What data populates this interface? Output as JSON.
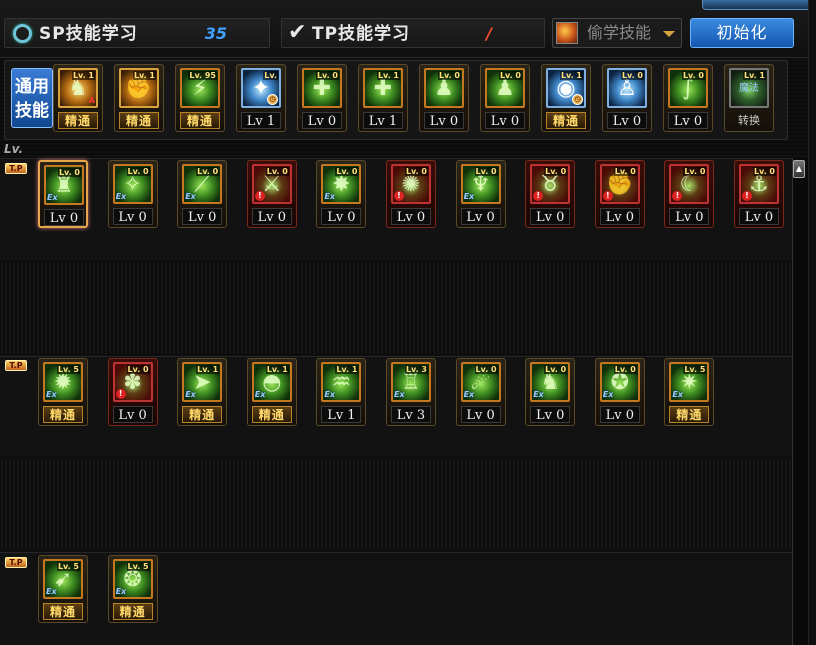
{
  "header": {
    "sp_label": "SP技能学习",
    "sp_value": "35",
    "tp_label": "TP技能学习",
    "tp_value": "/",
    "steal_label": "偷学技能",
    "reset_label": "初始化"
  },
  "common": {
    "label_line1": "通用",
    "label_line2": "技能",
    "items": [
      {
        "badge": "Lv. 1",
        "caption": "精通",
        "kind": "master",
        "style": "gold",
        "glyph": "♞",
        "marker": "A"
      },
      {
        "badge": "Lv. 1",
        "caption": "精通",
        "kind": "master",
        "style": "gold",
        "glyph": "✊"
      },
      {
        "badge": "Lv. 95",
        "caption": "精通",
        "kind": "master",
        "style": "green",
        "glyph": "⚡"
      },
      {
        "badge": "Lv.",
        "caption": "Lv 1",
        "kind": "level",
        "style": "blue",
        "glyph": "✦",
        "marker": "clock"
      },
      {
        "badge": "Lv. 0",
        "caption": "Lv 0",
        "kind": "level",
        "style": "green",
        "glyph": "✚"
      },
      {
        "badge": "Lv. 1",
        "caption": "Lv 1",
        "kind": "level",
        "style": "green",
        "glyph": "✚"
      },
      {
        "badge": "Lv. 0",
        "caption": "Lv 0",
        "kind": "level",
        "style": "green",
        "glyph": "♟"
      },
      {
        "badge": "Lv. 0",
        "caption": "Lv 0",
        "kind": "level",
        "style": "green",
        "glyph": "♟"
      },
      {
        "badge": "Lv. 1",
        "caption": "精通",
        "kind": "master",
        "style": "blue",
        "glyph": "◉",
        "marker": "clock"
      },
      {
        "badge": "Lv. 0",
        "caption": "Lv 0",
        "kind": "level",
        "style": "blue",
        "glyph": "♙"
      },
      {
        "badge": "Lv. 0",
        "caption": "Lv 0",
        "kind": "level",
        "style": "green",
        "glyph": "∫"
      },
      {
        "badge": "Lv. 1",
        "caption": "转换",
        "kind": "switch",
        "style": "gray",
        "glyph": "魔法"
      }
    ]
  },
  "lv_marker": "Lv.",
  "tp_marker": "T.P",
  "rows": [
    {
      "items": [
        {
          "badge": "Lv. 0",
          "caption": "Lv 0",
          "kind": "level",
          "style": "green",
          "glyph": "♜",
          "marker": "ex",
          "selected": true
        },
        {
          "badge": "Lv. 0",
          "caption": "Lv 0",
          "kind": "level",
          "style": "green",
          "glyph": "✧",
          "marker": "ex"
        },
        {
          "badge": "Lv. 0",
          "caption": "Lv 0",
          "kind": "level",
          "style": "green",
          "glyph": "⟋",
          "marker": "ex"
        },
        {
          "badge": "Lv. 0",
          "caption": "Lv 0",
          "kind": "level",
          "style": "red",
          "glyph": "⚔",
          "marker": "warn"
        },
        {
          "badge": "Lv. 0",
          "caption": "Lv 0",
          "kind": "level",
          "style": "green",
          "glyph": "✸",
          "marker": "ex"
        },
        {
          "badge": "Lv. 0",
          "caption": "Lv 0",
          "kind": "level",
          "style": "red",
          "glyph": "✺",
          "marker": "warn"
        },
        {
          "badge": "Lv. 0",
          "caption": "Lv 0",
          "kind": "level",
          "style": "green",
          "glyph": "♆",
          "marker": "ex"
        },
        {
          "badge": "Lv. 0",
          "caption": "Lv 0",
          "kind": "level",
          "style": "red",
          "glyph": "♉",
          "marker": "warn"
        },
        {
          "badge": "Lv. 0",
          "caption": "Lv 0",
          "kind": "level",
          "style": "red",
          "glyph": "✊",
          "marker": "warn"
        },
        {
          "badge": "Lv. 0",
          "caption": "Lv 0",
          "kind": "level",
          "style": "red",
          "glyph": "☾",
          "marker": "warn"
        },
        {
          "badge": "Lv. 0",
          "caption": "Lv 0",
          "kind": "level",
          "style": "red",
          "glyph": "⚓",
          "marker": "warn"
        }
      ]
    },
    {
      "items": [
        {
          "badge": "Lv. 5",
          "caption": "精通",
          "kind": "master",
          "style": "green",
          "glyph": "✹",
          "marker": "ex"
        },
        {
          "badge": "Lv. 0",
          "caption": "Lv 0",
          "kind": "level",
          "style": "red",
          "glyph": "✽",
          "marker": "warn"
        },
        {
          "badge": "Lv. 1",
          "caption": "精通",
          "kind": "master",
          "style": "green",
          "glyph": "➤",
          "marker": "ex"
        },
        {
          "badge": "Lv. 1",
          "caption": "精通",
          "kind": "master",
          "style": "green",
          "glyph": "◓",
          "marker": "ex"
        },
        {
          "badge": "Lv. 1",
          "caption": "Lv 1",
          "kind": "level",
          "style": "green",
          "glyph": "♒",
          "marker": "ex"
        },
        {
          "badge": "Lv. 3",
          "caption": "Lv 3",
          "kind": "level",
          "style": "green",
          "glyph": "♖",
          "marker": "ex"
        },
        {
          "badge": "Lv. 0",
          "caption": "Lv 0",
          "kind": "level",
          "style": "green",
          "glyph": "☄",
          "marker": "ex"
        },
        {
          "badge": "Lv. 0",
          "caption": "Lv 0",
          "kind": "level",
          "style": "green",
          "glyph": "♞",
          "marker": "ex"
        },
        {
          "badge": "Lv. 0",
          "caption": "Lv 0",
          "kind": "level",
          "style": "green",
          "glyph": "✪",
          "marker": "ex"
        },
        {
          "badge": "Lv. 5",
          "caption": "精通",
          "kind": "master",
          "style": "green",
          "glyph": "✷",
          "marker": "ex"
        }
      ]
    },
    {
      "items": [
        {
          "badge": "Lv. 5",
          "caption": "精通",
          "kind": "master",
          "style": "green",
          "glyph": "➹",
          "marker": "ex"
        },
        {
          "badge": "Lv. 5",
          "caption": "精通",
          "kind": "master",
          "style": "green",
          "glyph": "❂",
          "marker": "ex"
        }
      ]
    }
  ]
}
